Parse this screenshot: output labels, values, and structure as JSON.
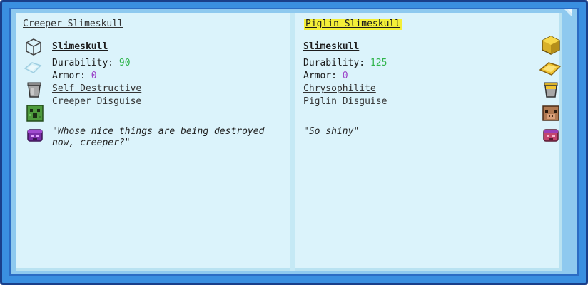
{
  "left": {
    "header": "Creeper Slimeskull",
    "name": "Slimeskull",
    "durability_label": "Durability:",
    "durability_value": "90",
    "armor_label": "Armor:",
    "armor_value": "0",
    "ability_1": "Self Destructive",
    "ability_2": "Creeper Disguise",
    "quote": "\"Whose nice things are being destroyed now, creeper?\""
  },
  "right": {
    "header": "Piglin Slimeskull",
    "name": "Slimeskull",
    "durability_label": "Durability:",
    "durability_value": "125",
    "armor_label": "Armor:",
    "armor_value": "0",
    "ability_1": "Chrysophilite",
    "ability_2": "Piglin Disguise",
    "quote": "\"So shiny\""
  },
  "colors": {
    "stat_green": "#2fb44b",
    "stat_purple": "#9b40c8",
    "highlight_yellow": "#f4ef38",
    "frame_blue": "#3a8fe0"
  },
  "icons": [
    "block-outline-icon",
    "slime-ingot-icon",
    "bucket-icon",
    "creeper-head-icon",
    "enderman-head-icon",
    "gold-block-icon",
    "gold-ingot-icon",
    "gold-bucket-icon",
    "piglin-head-icon",
    "pink-head-icon"
  ]
}
